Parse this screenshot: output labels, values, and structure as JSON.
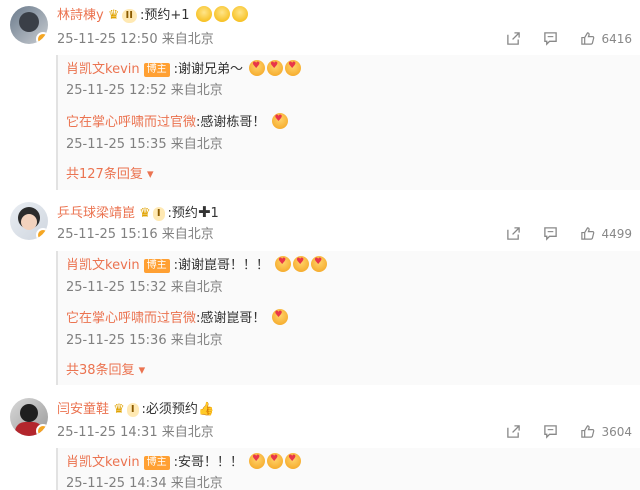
{
  "comments": [
    {
      "user": "林詩棟y",
      "level": "II",
      "text": ":预约+1",
      "time": "25-11-25 12:50 来自北京",
      "likes": "6416",
      "replies": [
        {
          "user": "肖凯文kevin",
          "tag": "博主",
          "text": ":谢谢兄弟～",
          "time": "25-11-25 12:52 来自北京"
        },
        {
          "user": "它在掌心呼啸而过官微",
          "text": ":感谢栋哥！",
          "time": "25-11-25 15:35 来自北京"
        }
      ],
      "more": "共127条回复"
    },
    {
      "user": "乒乓球梁靖崑",
      "level": "I",
      "text": ":预约",
      "text_suffix": "1",
      "time": "25-11-25 15:16 来自北京",
      "likes": "4499",
      "replies": [
        {
          "user": "肖凯文kevin",
          "tag": "博主",
          "text": ":谢谢崑哥！！！",
          "time": "25-11-25 15:32 来自北京"
        },
        {
          "user": "它在掌心呼啸而过官微",
          "text": ":感谢崑哥！",
          "time": "25-11-25 15:36 来自北京"
        }
      ],
      "more": "共38条回复"
    },
    {
      "user": "闫安童鞋",
      "level": "I",
      "text": ":必须预约",
      "time": "25-11-25 14:31 来自北京",
      "likes": "3604",
      "replies": [
        {
          "user": "肖凯文kevin",
          "tag": "博主",
          "text": ":安哥！！！",
          "time": "25-11-25 14:34 来自北京"
        }
      ]
    }
  ],
  "icons": {
    "share": "share-icon",
    "comment": "comment-icon",
    "like": "thumb-up-icon",
    "verified": "verified-badge-icon",
    "crown": "crown-icon"
  },
  "colors": {
    "username": "#eb7350",
    "meta": "#808080",
    "verified": "#f5a623"
  }
}
